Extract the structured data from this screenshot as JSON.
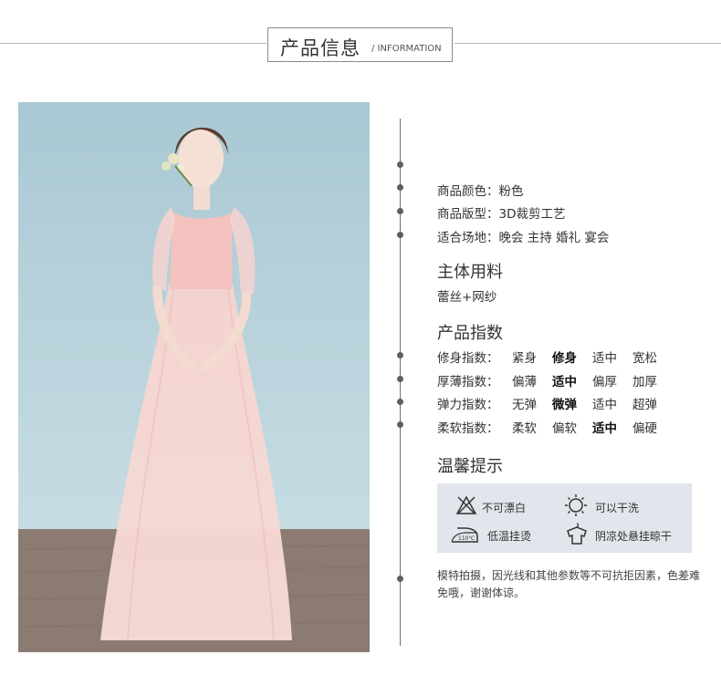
{
  "header": {
    "title_cn": "产品信息",
    "title_en": "/ INFORMATION"
  },
  "attributes": [
    {
      "label": "商品颜色：",
      "value": "粉色"
    },
    {
      "label": "商品版型：",
      "value": "3D裁剪工艺"
    },
    {
      "label": "适合场地：",
      "value": "晚会 主持 婚礼 宴会"
    }
  ],
  "material": {
    "heading": "主体用料",
    "value": "蕾丝+网纱"
  },
  "index": {
    "heading": "产品指数",
    "rows": [
      {
        "label": "修身指数：",
        "options": [
          "紧身",
          "修身",
          "适中",
          "宽松"
        ],
        "selected": 1
      },
      {
        "label": "厚薄指数：",
        "options": [
          "偏薄",
          "适中",
          "偏厚",
          "加厚"
        ],
        "selected": 1
      },
      {
        "label": "弹力指数：",
        "options": [
          "无弹",
          "微弹",
          "适中",
          "超弹"
        ],
        "selected": 1
      },
      {
        "label": "柔软指数：",
        "options": [
          "柔软",
          "偏软",
          "适中",
          "偏硬"
        ],
        "selected": 2
      }
    ]
  },
  "care": {
    "heading": "温馨提示",
    "items": [
      {
        "icon": "no-bleach-icon",
        "label": "不可漂白"
      },
      {
        "icon": "dry-sun-icon",
        "label": "可以干洗"
      },
      {
        "icon": "low-iron-icon",
        "label": "低温挂烫",
        "icon_text": "110℃"
      },
      {
        "icon": "shade-dry-icon",
        "label": "阴凉处悬挂晾干"
      }
    ]
  },
  "note": "模特拍摄，因光线和其他参数等不可抗拒因素，色差难免哦，谢谢体谅。",
  "colors": {
    "accent_dot": "#5f5f5f",
    "care_bg": "#e2e5ec",
    "dress_pink": "#f4c9c6"
  }
}
